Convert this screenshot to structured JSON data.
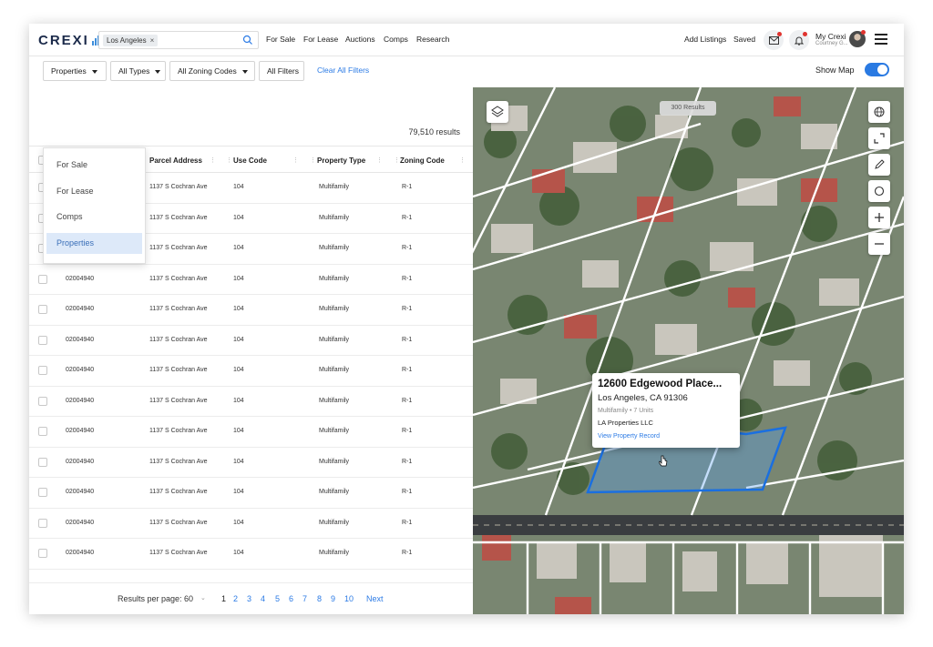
{
  "app": {
    "logo_text": "CREXI",
    "accent": "#2a7ae2"
  },
  "search": {
    "chip_label": "Los Angeles",
    "chip_remove": "×",
    "placeholder": ""
  },
  "nav": [
    "For Sale",
    "For Lease",
    "Auctions",
    "Comps",
    "Research"
  ],
  "header_right": {
    "add_listings": "Add Listings",
    "saved": "Saved",
    "account_label": "My Crexi",
    "account_sub": "Courtney G..."
  },
  "filters": {
    "properties": "Properties",
    "all_types": "All Types",
    "zoning": "All Zoning Codes",
    "all_filters": "All Filters",
    "clear": "Clear All Filters",
    "show_map": "Show Map",
    "show_map_on": true
  },
  "dropdown": {
    "items": [
      "For Sale",
      "For Lease",
      "Comps",
      "Properties"
    ],
    "selected": "Properties"
  },
  "table": {
    "results": "79,510 results",
    "columns": [
      "Parcel Address",
      "Use Code",
      "Property Type",
      "Zoning Code"
    ],
    "rows": [
      [
        "",
        "1137 S Cochran Ave",
        "104",
        "Multifamily",
        "R-1"
      ],
      [
        "02004940",
        "1137 S Cochran Ave",
        "104",
        "Multifamily",
        "R-1"
      ],
      [
        "02004940",
        "1137 S Cochran Ave",
        "104",
        "Multifamily",
        "R-1"
      ],
      [
        "02004940",
        "1137 S Cochran Ave",
        "104",
        "Multifamily",
        "R-1"
      ],
      [
        "02004940",
        "1137 S Cochran Ave",
        "104",
        "Multifamily",
        "R-1"
      ],
      [
        "02004940",
        "1137 S Cochran Ave",
        "104",
        "Multifamily",
        "R-1"
      ],
      [
        "02004940",
        "1137 S Cochran Ave",
        "104",
        "Multifamily",
        "R-1"
      ],
      [
        "02004940",
        "1137 S Cochran Ave",
        "104",
        "Multifamily",
        "R-1"
      ],
      [
        "02004940",
        "1137 S Cochran Ave",
        "104",
        "Multifamily",
        "R-1"
      ],
      [
        "02004940",
        "1137 S Cochran Ave",
        "104",
        "Multifamily",
        "R-1"
      ],
      [
        "02004940",
        "1137 S Cochran Ave",
        "104",
        "Multifamily",
        "R-1"
      ],
      [
        "02004940",
        "1137 S Cochran Ave",
        "104",
        "Multifamily",
        "R-1"
      ],
      [
        "02004940",
        "1137 S Cochran Ave",
        "104",
        "Multifamily",
        "R-1"
      ]
    ]
  },
  "pagination": {
    "per_page": "Results per page: 60",
    "pages": [
      "1",
      "2",
      "3",
      "4",
      "5",
      "6",
      "7",
      "8",
      "9",
      "10"
    ],
    "current": "1",
    "next": "Next"
  },
  "map": {
    "results_pill": "300 Results",
    "popup": {
      "title": "12600 Edgewood Place...",
      "city": "Los Angeles, CA 91306",
      "meta": "Multifamily • 7 Units",
      "owner": "LA Properties LLC",
      "link": "View Property Record"
    },
    "controls": [
      "globe-icon",
      "expand-icon",
      "pencil-icon",
      "circle-draw-icon",
      "zoom-in-icon",
      "zoom-out-icon"
    ]
  }
}
